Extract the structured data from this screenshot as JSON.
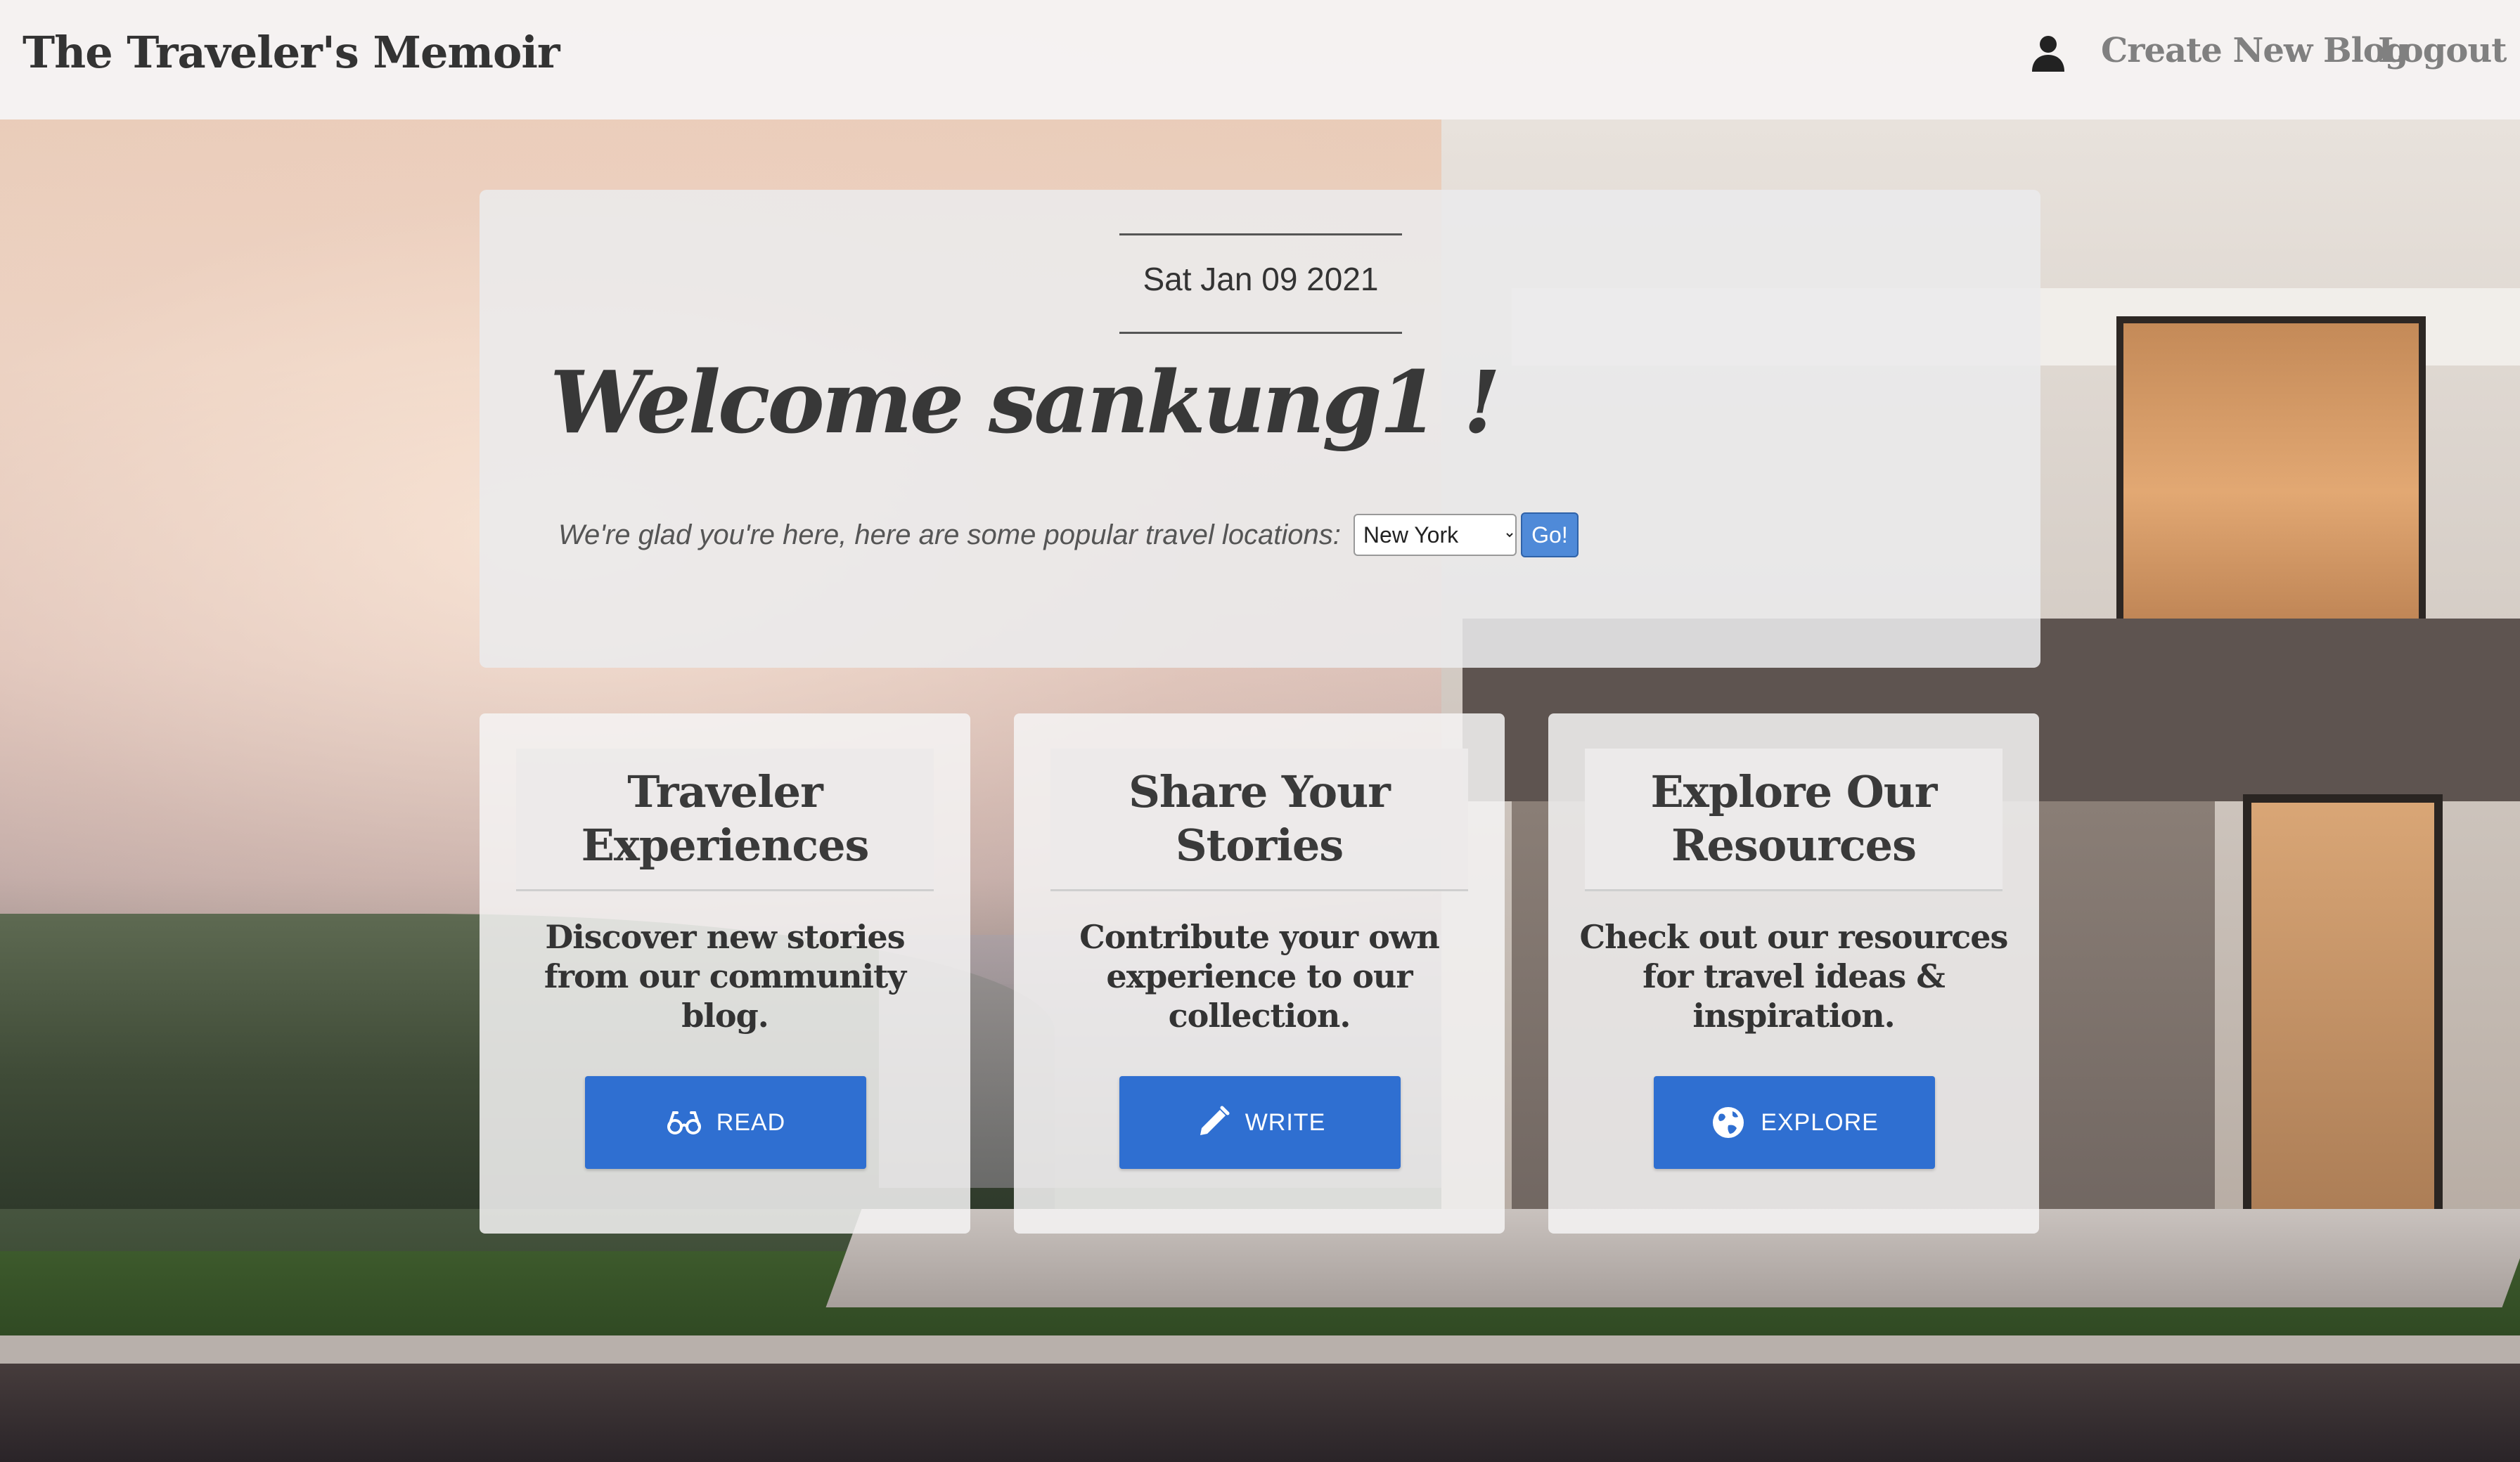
{
  "header": {
    "brand": "The Traveler's Memoir",
    "links": {
      "create": "Create New Blog",
      "logout": "Logout"
    },
    "icons": {
      "user": "user-icon"
    }
  },
  "welcome": {
    "date": "Sat Jan 09 2021",
    "title": "Welcome sankung1 !",
    "subtitle": "We're glad you're here, here are some popular travel locations:",
    "location_select": {
      "selected": "New York"
    },
    "go_label": "Go!"
  },
  "cards": [
    {
      "title": "Traveler Experiences",
      "text": "Discover new stories from our community blog.",
      "button_label": "READ",
      "icon": "glasses-icon"
    },
    {
      "title": "Share Your Stories",
      "text": "Contribute your own experience to our collection.",
      "button_label": "WRITE",
      "icon": "pencil-icon"
    },
    {
      "title": "Explore Our Resources",
      "text": "Check out our resources for travel ideas & inspiration.",
      "button_label": "EXPLORE",
      "icon": "globe-icon"
    }
  ],
  "colors": {
    "accent_button": "#2f6fd1",
    "go_button": "#4f8ad8",
    "nav_link": "#808080"
  }
}
